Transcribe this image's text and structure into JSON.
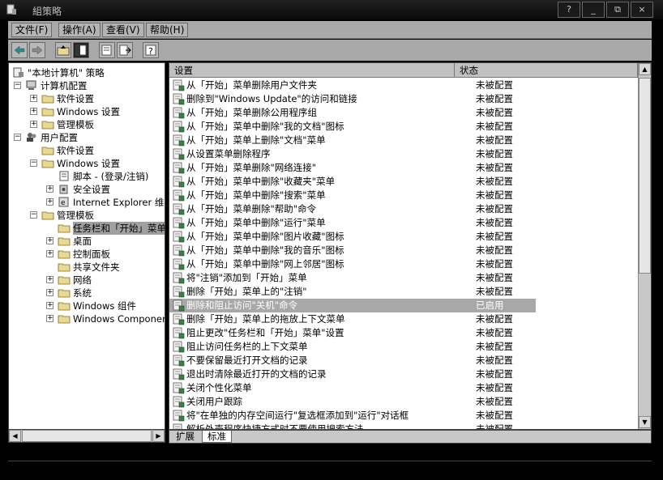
{
  "window": {
    "title": "組策略",
    "buttons": [
      "?",
      "_",
      "⧉",
      "×"
    ]
  },
  "menu": [
    {
      "label": "文件(F)"
    },
    {
      "label": "操作(A)"
    },
    {
      "label": "查看(V)"
    },
    {
      "label": "帮助(H)"
    }
  ],
  "toolbar": {
    "back_icon": "back-arrow-icon",
    "forward_icon": "forward-arrow-icon",
    "up_icon": "folder-up-icon",
    "show_tree_icon": "console-tree-icon",
    "properties_icon": "properties-icon",
    "export_icon": "export-list-icon",
    "help_icon": "help-icon"
  },
  "tree": [
    {
      "label": "\"本地计算机\" 策略",
      "level": 0,
      "icon": "policy-icon",
      "expander": ""
    },
    {
      "label": "计算机配置",
      "level": 1,
      "icon": "computer-icon",
      "expander": "-"
    },
    {
      "label": "软件设置",
      "level": 2,
      "icon": "folder-icon",
      "expander": "+"
    },
    {
      "label": "Windows 设置",
      "level": 2,
      "icon": "folder-icon",
      "expander": "+"
    },
    {
      "label": "管理模板",
      "level": 2,
      "icon": "folder-icon",
      "expander": "+"
    },
    {
      "label": "用户配置",
      "level": 1,
      "icon": "users-icon",
      "expander": "-"
    },
    {
      "label": "软件设置",
      "level": 2,
      "icon": "folder-icon",
      "expander": ""
    },
    {
      "label": "Windows 设置",
      "level": 2,
      "icon": "folder-icon",
      "expander": "-"
    },
    {
      "label": "脚本 - (登录/注销)",
      "level": 3,
      "icon": "script-icon",
      "expander": ""
    },
    {
      "label": "安全设置",
      "level": 3,
      "icon": "security-icon",
      "expander": "+"
    },
    {
      "label": "Internet Explorer 维护",
      "level": 3,
      "icon": "ie-icon",
      "expander": "+"
    },
    {
      "label": "管理模板",
      "level": 2,
      "icon": "folder-icon",
      "expander": "-"
    },
    {
      "label": "任务栏和「开始」菜单",
      "level": 3,
      "icon": "folder-open-icon",
      "expander": "",
      "selected": true
    },
    {
      "label": "桌面",
      "level": 3,
      "icon": "folder-icon",
      "expander": "+"
    },
    {
      "label": "控制面板",
      "level": 3,
      "icon": "folder-icon",
      "expander": "+"
    },
    {
      "label": "共享文件夹",
      "level": 3,
      "icon": "folder-icon",
      "expander": ""
    },
    {
      "label": "网络",
      "level": 3,
      "icon": "folder-icon",
      "expander": "+"
    },
    {
      "label": "系统",
      "level": 3,
      "icon": "folder-icon",
      "expander": "+"
    },
    {
      "label": "Windows 组件",
      "level": 3,
      "icon": "folder-icon",
      "expander": "+"
    },
    {
      "label": "Windows Components",
      "level": 3,
      "icon": "folder-icon",
      "expander": "+"
    }
  ],
  "list": {
    "headers": {
      "setting": "设置",
      "status": "状态"
    },
    "rows": [
      {
        "name": "从「开始」菜单删除用户文件夹",
        "status": "未被配置"
      },
      {
        "name": "删除到\"Windows Update\"的访问和链接",
        "status": "未被配置"
      },
      {
        "name": "从「开始」菜单删除公用程序组",
        "status": "未被配置"
      },
      {
        "name": "从「开始」菜单中删除\"我的文档\"图标",
        "status": "未被配置"
      },
      {
        "name": "从「开始」菜单上删除\"文档\"菜单",
        "status": "未被配置"
      },
      {
        "name": "从设置菜单删除程序",
        "status": "未被配置"
      },
      {
        "name": "从「开始」菜单删除\"网络连接\"",
        "status": "未被配置"
      },
      {
        "name": "从「开始」菜单中删除\"收藏夹\"菜单",
        "status": "未被配置"
      },
      {
        "name": "从「开始」菜单中删除\"搜索\"菜单",
        "status": "未被配置"
      },
      {
        "name": "从「开始」菜单删除\"帮助\"命令",
        "status": "未被配置"
      },
      {
        "name": "从「开始」菜单中删除\"运行\"菜单",
        "status": "未被配置"
      },
      {
        "name": "从「开始」菜单中删除\"图片收藏\"图标",
        "status": "未被配置"
      },
      {
        "name": "从「开始」菜单中删除\"我的音乐\"图标",
        "status": "未被配置"
      },
      {
        "name": "从「开始」菜单中删除\"网上邻居\"图标",
        "status": "未被配置"
      },
      {
        "name": "将\"注销\"添加到「开始」菜单",
        "status": "未被配置"
      },
      {
        "name": "删除「开始」菜单上的\"注销\"",
        "status": "未被配置"
      },
      {
        "name": "删除和阻止访问\"关机\"命令",
        "status": "已启用",
        "highlight": true
      },
      {
        "name": "删除「开始」菜单上的拖放上下文菜单",
        "status": "未被配置"
      },
      {
        "name": "阻止更改\"任务栏和「开始」菜单\"设置",
        "status": "未被配置"
      },
      {
        "name": "阻止访问任务栏的上下文菜单",
        "status": "未被配置"
      },
      {
        "name": "不要保留最近打开文档的记录",
        "status": "未被配置"
      },
      {
        "name": "退出时清除最近打开的文档的记录",
        "status": "未被配置"
      },
      {
        "name": "关闭个性化菜单",
        "status": "未被配置"
      },
      {
        "name": "关闭用户跟踪",
        "status": "未被配置"
      },
      {
        "name": "将\"在单独的内存空间运行\"复选框添加到\"运行\"对话框",
        "status": "未被配置"
      },
      {
        "name": "解析外壳程序快捷方式时不要使用搜索方法",
        "status": "未被配置"
      }
    ]
  },
  "tabs": [
    {
      "label": "扩展"
    },
    {
      "label": "标准",
      "active": true
    }
  ]
}
